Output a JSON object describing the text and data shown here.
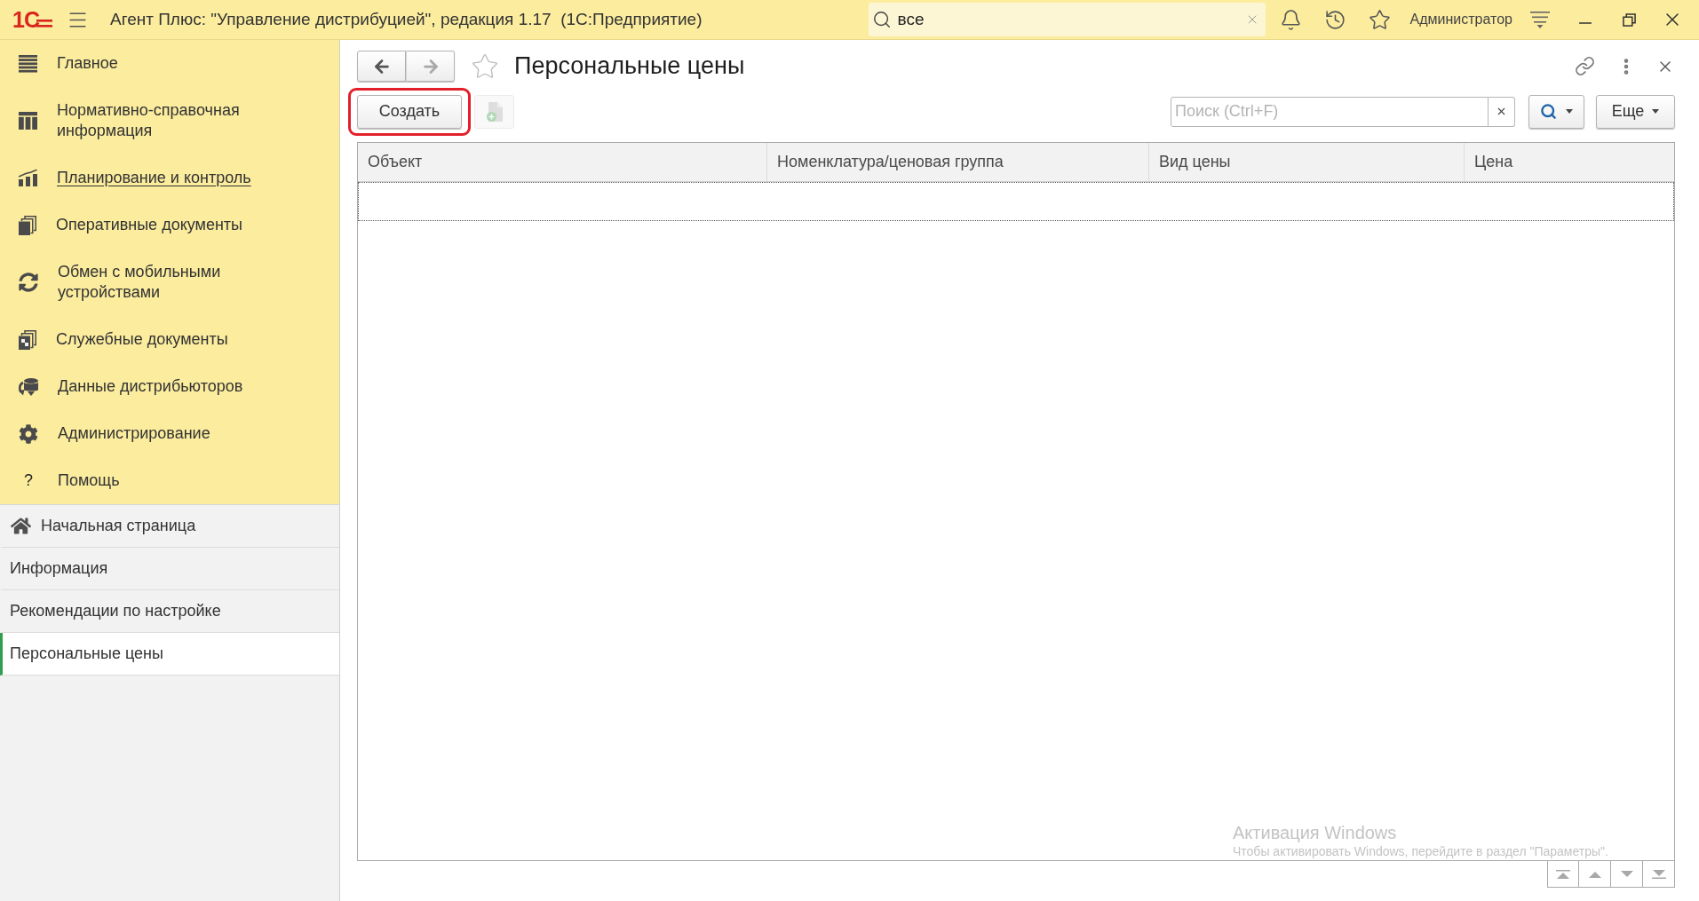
{
  "app_bar": {
    "logo": "1С",
    "title": "Агент Плюс: \"Управление дистрибуцией\", редакция 1.17  (1С:Предприятие)",
    "search": {
      "value": "все"
    },
    "user": "Администратор"
  },
  "sidebar": {
    "sections": [
      {
        "label": "Главное",
        "hovered": false
      },
      {
        "label": "Нормативно-справочная информация",
        "hovered": false
      },
      {
        "label": "Планирование и контроль",
        "hovered": true
      },
      {
        "label": "Оперативные документы",
        "hovered": false
      },
      {
        "label": "Обмен с мобильными устройствами",
        "hovered": false
      },
      {
        "label": "Служебные документы",
        "hovered": false
      },
      {
        "label": "Данные дистрибьюторов",
        "hovered": false
      },
      {
        "label": "Администрирование",
        "hovered": false
      },
      {
        "label": "Помощь",
        "hovered": false,
        "glyph": "?"
      }
    ],
    "open_pages": [
      {
        "label": "Начальная страница",
        "selected": false
      },
      {
        "label": "Информация",
        "selected": false
      },
      {
        "label": "Рекомендации по настройке",
        "selected": false
      },
      {
        "label": "Персональные цены",
        "selected": true
      }
    ]
  },
  "form": {
    "back_disabled": false,
    "forward_disabled": true,
    "favorite": false,
    "title": "Персональные цены",
    "create_button": {
      "label": "Создать",
      "highlighted": true
    },
    "copy_button": {
      "disabled": true
    },
    "search": {
      "placeholder": "Поиск (Ctrl+F)"
    },
    "more_button": "Еще",
    "table": {
      "columns": [
        "Объект",
        "Номенклатура/ценовая группа",
        "Вид цены",
        "Цена"
      ]
    }
  },
  "os_notice": {
    "title": "Активация Windows",
    "text": "Чтобы активировать Windows, перейдите в раздел \"Параметры\"."
  }
}
